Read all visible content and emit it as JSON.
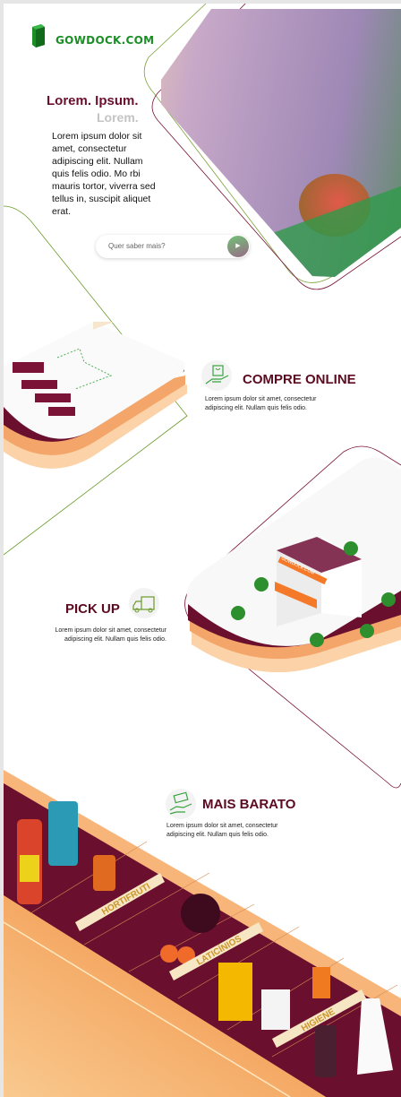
{
  "brand": {
    "name": "GOWDOCK.COM",
    "color": "#1b8f25",
    "icon": "book-logo-icon"
  },
  "hero": {
    "title": "Lorem. Ipsum.",
    "subtitle": "Lorem.",
    "body": "Lorem ipsum dolor sit amet, consectetur adipiscing elit. Nullam quis felis odio. Mo rbi mauris tortor, viverra sed tellus in, suscipit aliquet erat.",
    "cta_placeholder": "Quer saber mais?",
    "cta_icon": "play-icon"
  },
  "features": [
    {
      "title": "COMPRE ONLINE",
      "icon": "hand-shopping-bag-icon",
      "desc": "Lorem ipsum dolor sit amet, consectetur adipiscing elit. Nullam quis felis odio."
    },
    {
      "title": "PICK UP",
      "icon": "delivery-truck-icon",
      "desc": "Lorem ipsum dolor sit amet, consectetur adipiscing elit. Nullam quis felis odio."
    },
    {
      "title": "MAIS BARATO",
      "icon": "hand-money-icon",
      "desc": "Lorem ipsum dolor sit amet, consectetur adipiscing elit. Nullam quis felis odio."
    }
  ],
  "store_sign": "GOWDOCK.COM",
  "shelf_labels": [
    "HORTIFRUTI",
    "LATICÍNIOS",
    "HIGIENE"
  ],
  "colors": {
    "primary": "#6b0f2e",
    "accent_green": "#1b8f25",
    "orange": "#f4a060",
    "line_green": "#6a9a2a"
  }
}
